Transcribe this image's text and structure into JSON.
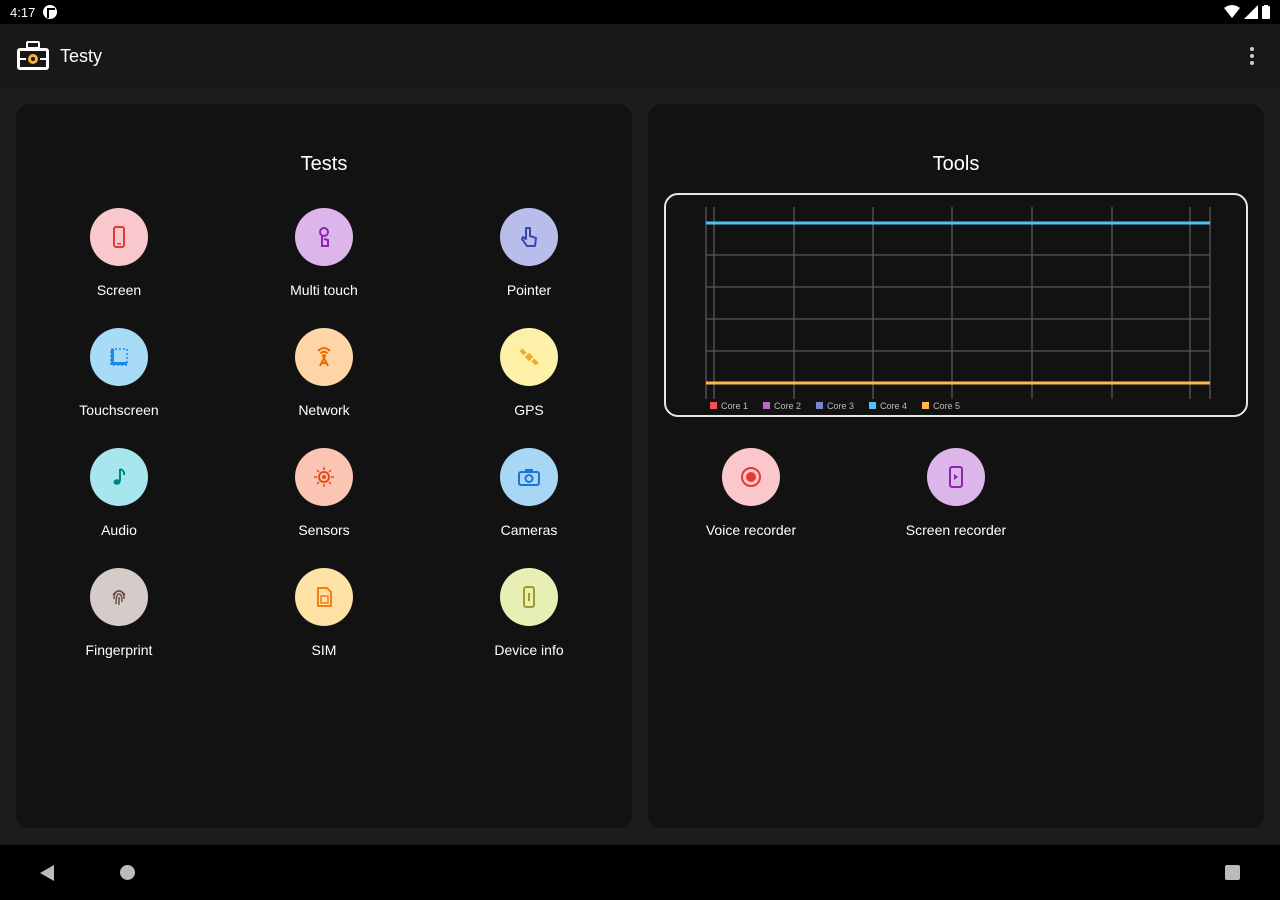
{
  "status_bar": {
    "time": "4:17"
  },
  "app_bar": {
    "title": "Testy"
  },
  "tests": {
    "title": "Tests",
    "items": [
      {
        "label": "Screen",
        "icon": "phone-icon",
        "color": "#f9c8cc"
      },
      {
        "label": "Multi touch",
        "icon": "multi-touch-icon",
        "color": "#dcb6ea"
      },
      {
        "label": "Pointer",
        "icon": "pointer-hand-icon",
        "color": "#b9bdec"
      },
      {
        "label": "Touchscreen",
        "icon": "touchscreen-icon",
        "color": "#a8dbf6"
      },
      {
        "label": "Network",
        "icon": "network-antenna-icon",
        "color": "#fdd5a6"
      },
      {
        "label": "GPS",
        "icon": "satellite-icon",
        "color": "#fdf0a8"
      },
      {
        "label": "Audio",
        "icon": "music-note-icon",
        "color": "#a8e6ee"
      },
      {
        "label": "Sensors",
        "icon": "sensor-icon",
        "color": "#fbc5b4"
      },
      {
        "label": "Cameras",
        "icon": "camera-icon",
        "color": "#a8d7f6"
      },
      {
        "label": "Fingerprint",
        "icon": "fingerprint-icon",
        "color": "#d5ccca"
      },
      {
        "label": "SIM",
        "icon": "sim-card-icon",
        "color": "#fde1a5"
      },
      {
        "label": "Device info",
        "icon": "device-info-icon",
        "color": "#e8efb4"
      }
    ]
  },
  "tools": {
    "title": "Tools",
    "items": [
      {
        "label": "Voice recorder",
        "icon": "record-icon",
        "color": "#fac8cc"
      },
      {
        "label": "Screen recorder",
        "icon": "screen-recorder-icon",
        "color": "#dcb6ea"
      }
    ]
  },
  "chart_data": {
    "type": "line",
    "series": [
      {
        "name": "Core 1",
        "color": "#ef5350"
      },
      {
        "name": "Core 2",
        "color": "#ba68c8"
      },
      {
        "name": "Core 3",
        "color": "#7986cb"
      },
      {
        "name": "Core 4",
        "color": "#4fc3f7",
        "level": 1.0
      },
      {
        "name": "Core 5",
        "color": "#ffb74d",
        "level": 0.0
      }
    ],
    "grid": true,
    "legend": "bottom-left"
  },
  "colors": {
    "accent_test": "#e53935",
    "background": "#1c1c1c",
    "panel": "#121212"
  }
}
